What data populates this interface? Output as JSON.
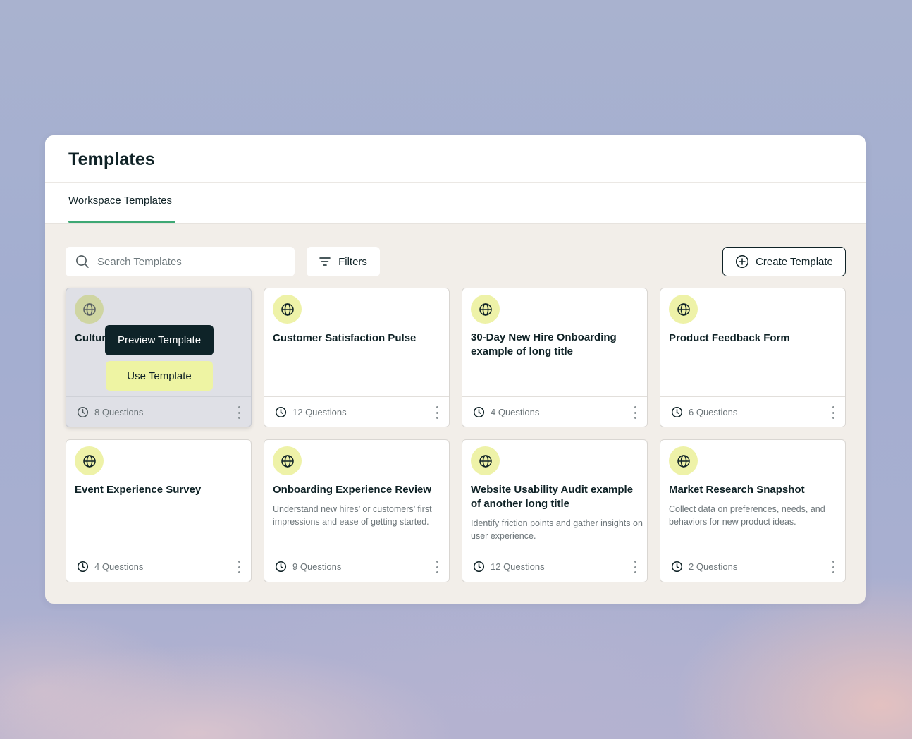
{
  "header": {
    "title": "Templates",
    "tab_label": "Workspace Templates"
  },
  "toolbar": {
    "search_placeholder": "Search Templates",
    "filters_label": "Filters",
    "create_label": "Create Template"
  },
  "colors": {
    "accent_underline": "#3ea874",
    "icon_badge": "#eef2a8",
    "dark_button": "#0e2328",
    "use_button": "#eef4a3"
  },
  "hover_actions": {
    "preview_label": "Preview Template",
    "use_label": "Use Template"
  },
  "cards": [
    {
      "title": "Cultur",
      "description": "",
      "questions": "8 Questions",
      "icon": "globe-icon"
    },
    {
      "title": "Customer Satisfaction Pulse",
      "description": "",
      "questions": "12 Questions",
      "icon": "globe-icon"
    },
    {
      "title": "30-Day New Hire Onboarding example of long title",
      "description": "",
      "questions": "4 Questions",
      "icon": "globe-icon"
    },
    {
      "title": "Product Feedback Form",
      "description": "",
      "questions": "6 Questions",
      "icon": "globe-icon"
    },
    {
      "title": "Event Experience Survey",
      "description": "",
      "questions": "4 Questions",
      "icon": "globe-icon"
    },
    {
      "title": "Onboarding Experience Review",
      "description": "Understand new hires’ or customers’ first impressions and ease of getting started.",
      "questions": "9 Questions",
      "icon": "globe-icon"
    },
    {
      "title": "Website Usability Audit example of another long title",
      "description": "Identify friction points and gather insights on user experience.",
      "questions": "12 Questions",
      "icon": "globe-icon"
    },
    {
      "title": "Market Research Snapshot",
      "description": "Collect data on preferences, needs, and behaviors for new product ideas.",
      "questions": "2 Questions",
      "icon": "globe-icon"
    }
  ]
}
